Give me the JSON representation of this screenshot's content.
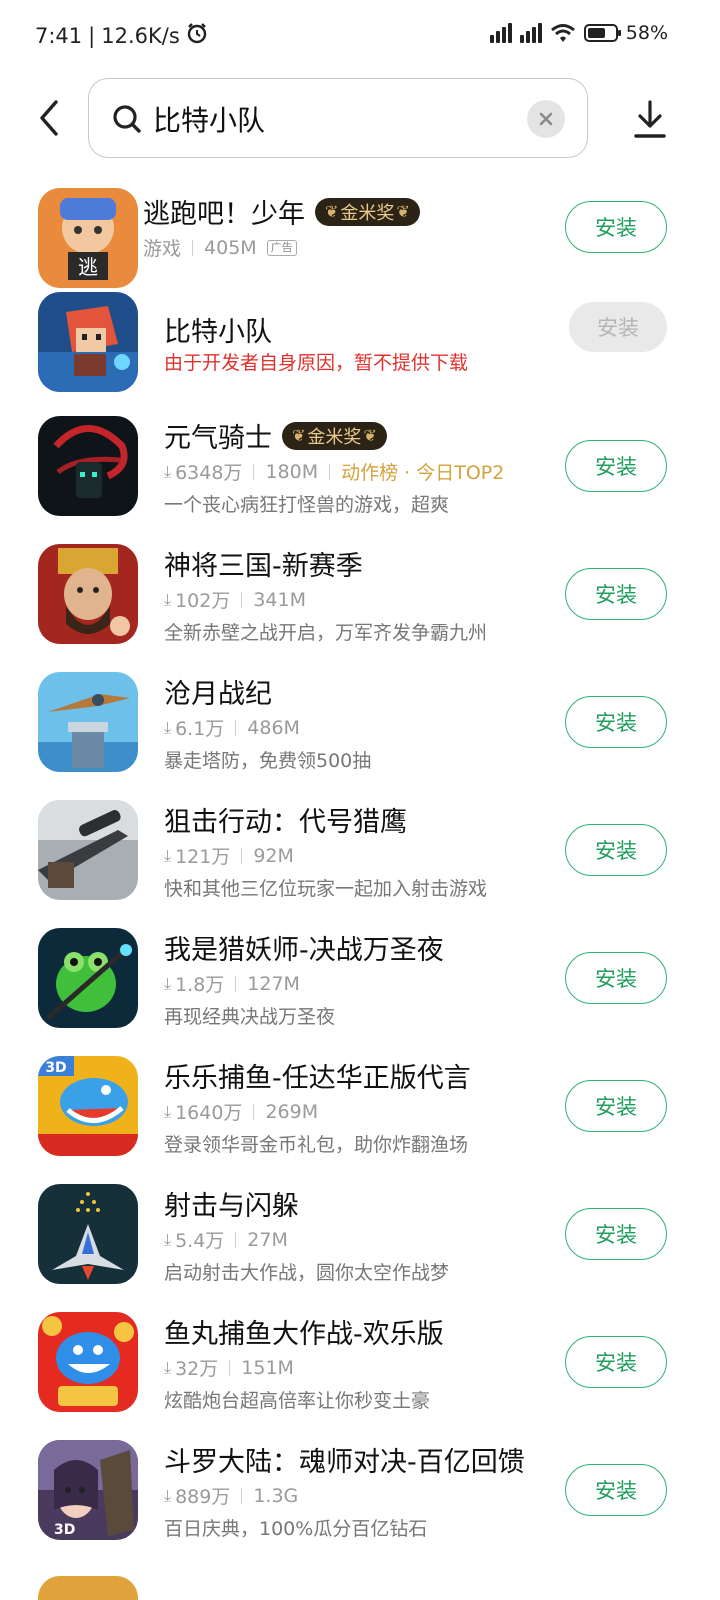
{
  "status_bar": {
    "time": "7:41",
    "speed": "12.6K/s",
    "battery": "58%",
    "battery_level": 0.58,
    "alarm_icon": "alarm-icon"
  },
  "search": {
    "value": "比特小队",
    "placeholder": ""
  },
  "colors": {
    "accent": "#2db36f",
    "warning": "#e0322d",
    "rank": "#d4a23a"
  },
  "apps": [
    {
      "name": "逃跑吧！少年",
      "award": "金米奖",
      "category": "游戏",
      "size": "405M",
      "ad": "广告",
      "install": "安装"
    },
    {
      "name": "比特小队",
      "warning": "由于开发者自身原因，暂不提供下载",
      "install": "安装",
      "disabled": true
    },
    {
      "name": "元气骑士",
      "award": "金米奖",
      "downloads": "6348万",
      "size": "180M",
      "rank": "动作榜 · 今日TOP2",
      "desc": "一个丧心病狂打怪兽的游戏，超爽",
      "install": "安装"
    },
    {
      "name": "神将三国-新赛季",
      "downloads": "102万",
      "size": "341M",
      "desc": "全新赤壁之战开启，万军齐发争霸九州",
      "install": "安装"
    },
    {
      "name": "沧月战纪",
      "downloads": "6.1万",
      "size": "486M",
      "desc": "暴走塔防，免费领500抽",
      "install": "安装"
    },
    {
      "name": "狙击行动：代号猎鹰",
      "downloads": "121万",
      "size": "92M",
      "desc": "快和其他三亿位玩家一起加入射击游戏",
      "install": "安装"
    },
    {
      "name": "我是猎妖师-决战万圣夜",
      "downloads": "1.8万",
      "size": "127M",
      "desc": "再现经典决战万圣夜",
      "install": "安装"
    },
    {
      "name": "乐乐捕鱼-任达华正版代言",
      "downloads": "1640万",
      "size": "269M",
      "desc": "登录领华哥金币礼包，助你炸翻渔场",
      "install": "安装"
    },
    {
      "name": "射击与闪躲",
      "downloads": "5.4万",
      "size": "27M",
      "desc": "启动射击大作战，圆你太空作战梦",
      "install": "安装"
    },
    {
      "name": "鱼丸捕鱼大作战-欢乐版",
      "downloads": "32万",
      "size": "151M",
      "desc": "炫酷炮台超高倍率让你秒变土豪",
      "install": "安装"
    },
    {
      "name": "斗罗大陆：魂师对决-百亿回馈",
      "downloads": "889万",
      "size": "1.3G",
      "desc": "百日庆典，100%瓜分百亿钻石",
      "install": "安装"
    }
  ]
}
